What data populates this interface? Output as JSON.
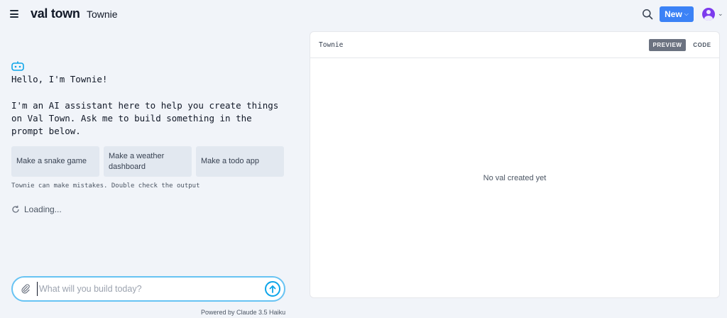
{
  "header": {
    "menu_icon": "hamburger-icon",
    "logo": "val town",
    "title": "Townie",
    "search_icon": "search-icon",
    "new_button": "New",
    "avatar_icon": "user-avatar-icon"
  },
  "chat": {
    "assistant_icon": "robot-icon",
    "greeting": "Hello, I'm Townie!",
    "intro": "I'm an AI assistant here to help you create things on Val Town. Ask me to build something in the prompt below.",
    "suggestions": [
      "Make a snake game",
      "Make a weather dashboard",
      "Make a todo app"
    ],
    "disclaimer": "Townie can make mistakes. Double check the output",
    "loading": "Loading..."
  },
  "prompt": {
    "value": "",
    "placeholder": "What will you build today?",
    "attach_icon": "paperclip-icon",
    "submit_icon": "arrow-up-icon",
    "powered_by": "Powered by Claude 3.5 Haiku"
  },
  "preview_panel": {
    "title": "Townie",
    "tabs": [
      {
        "label": "PREVIEW",
        "active": true
      },
      {
        "label": "CODE",
        "active": false
      }
    ],
    "empty_message": "No val created yet"
  },
  "colors": {
    "accent": "#3b82f6",
    "prompt_border": "#67c3f3",
    "background": "#f1f4f9"
  }
}
